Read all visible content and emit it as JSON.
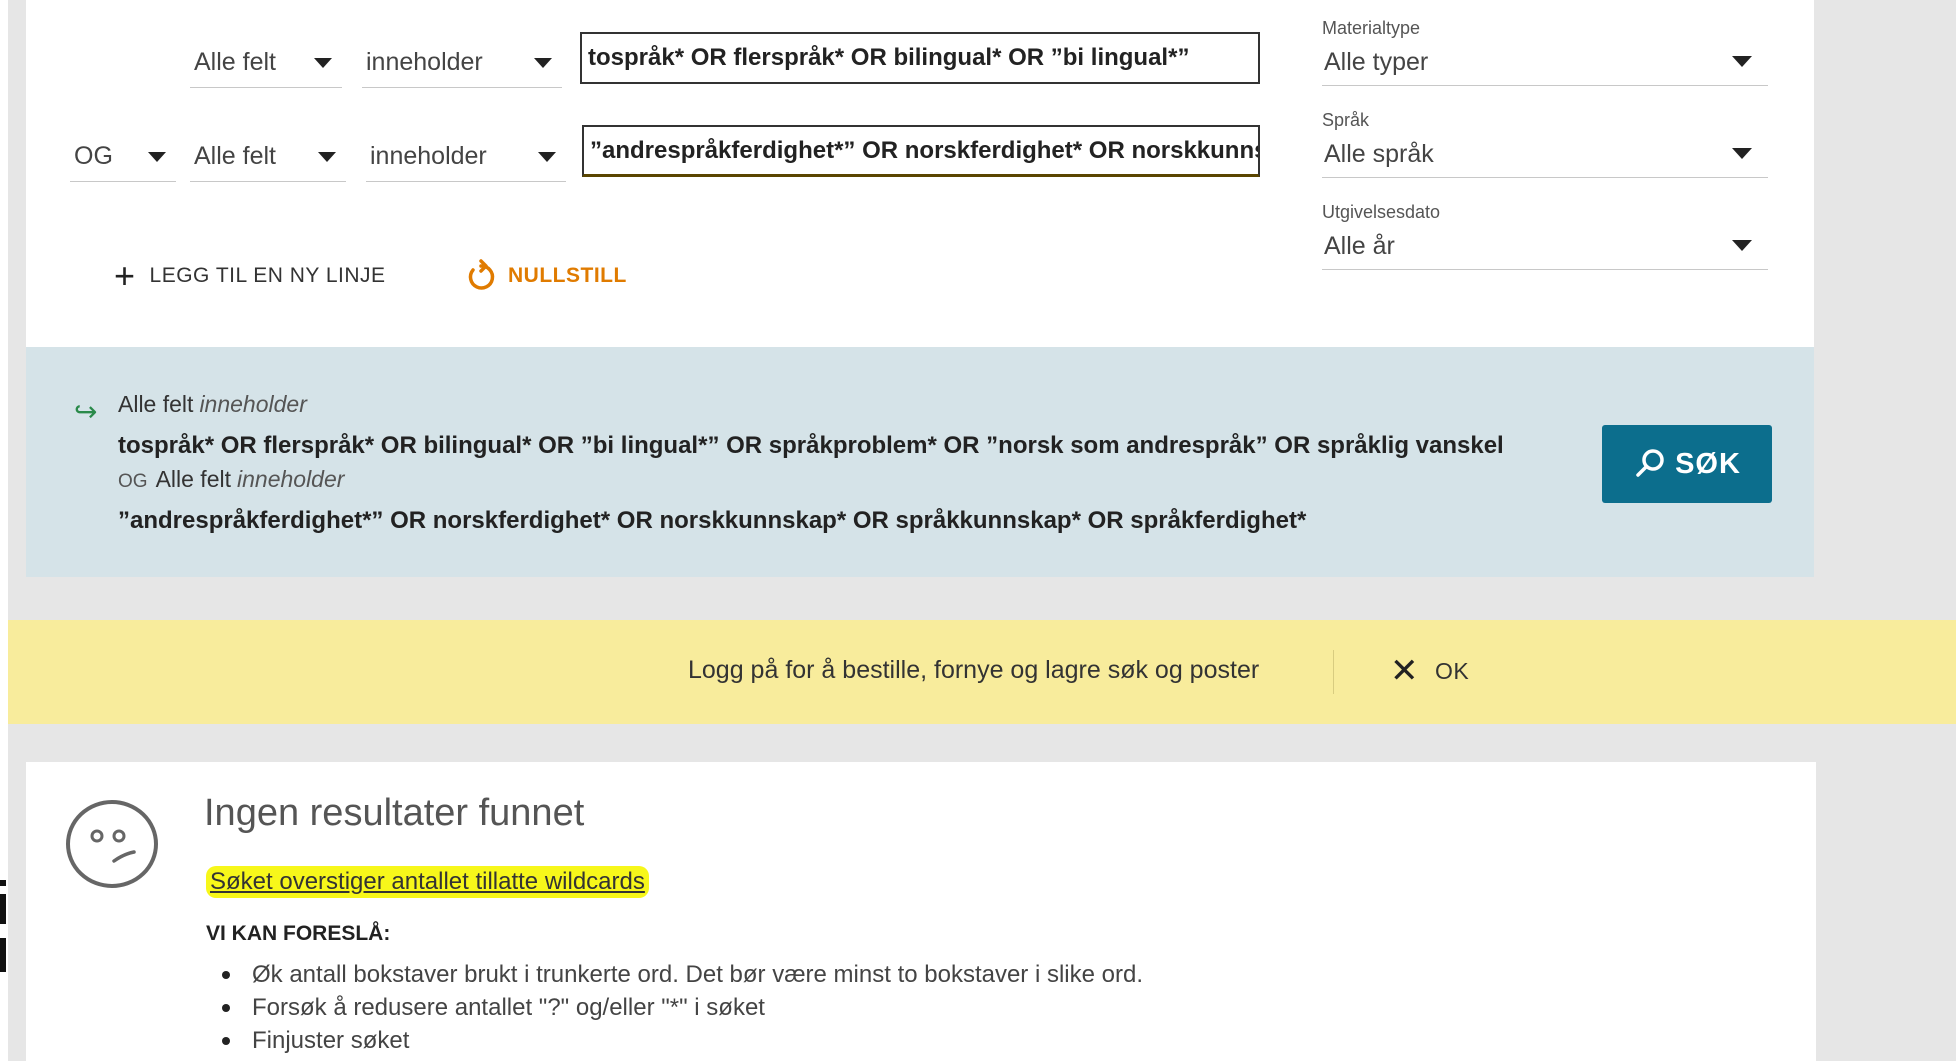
{
  "search_rows": [
    {
      "operator": "",
      "field": "Alle felt",
      "condition": "inneholder",
      "query": "tospråk* OR flerspråk* OR bilingual* OR ”bi lingual*”"
    },
    {
      "operator": "OG",
      "field": "Alle felt",
      "condition": "inneholder",
      "query": "”andrespråkferdighet*” OR norskferdighet* OR norskkunnskap* OR språkkunnskap* OR språkferdighet*"
    }
  ],
  "filters": {
    "material": {
      "label": "Materialtype",
      "value": "Alle typer"
    },
    "language": {
      "label": "Språk",
      "value": "Alle språk"
    },
    "date": {
      "label": "Utgivelsesdato",
      "value": "Alle år"
    }
  },
  "actions": {
    "add_line": "LEGG TIL EN NY LINJE",
    "reset": "NULLSTILL",
    "search": "SØK"
  },
  "summary": {
    "line1_field": "Alle felt",
    "line1_condition": "inneholder",
    "line1_query": "tospråk* OR flerspråk* OR bilingual* OR ”bi lingual*” OR språkproblem* OR ”norsk som andrespråk” OR språklig vanskel",
    "line2_operator": "OG",
    "line2_field": "Alle felt",
    "line2_condition": "inneholder",
    "line2_query": "”andrespråkferdighet*” OR norskferdighet* OR norskkunnskap* OR språkkunnskap* OR språkferdighet*"
  },
  "banner": {
    "message": "Logg på for å bestille, fornye og lagre søk og poster",
    "ok": "OK"
  },
  "results": {
    "title": "Ingen resultater funnet",
    "warning": "Søket overstiger antallet tillatte wildcards",
    "suggest_heading": "VI KAN FORESLÅ:",
    "suggestions": [
      "Øk antall bokstaver brukt i trunkerte ord. Det bør være minst to bokstaver i slike ord.",
      "Forsøk å redusere antallet \"?\" og/eller \"*\" i søket",
      "Finjuster søket"
    ]
  },
  "colors": {
    "accent_orange": "#e07b00",
    "search_button": "#0c6e8d",
    "summary_bg": "#d5e3e8",
    "banner_bg": "#f8ec9c",
    "highlight": "#f7f71a"
  }
}
